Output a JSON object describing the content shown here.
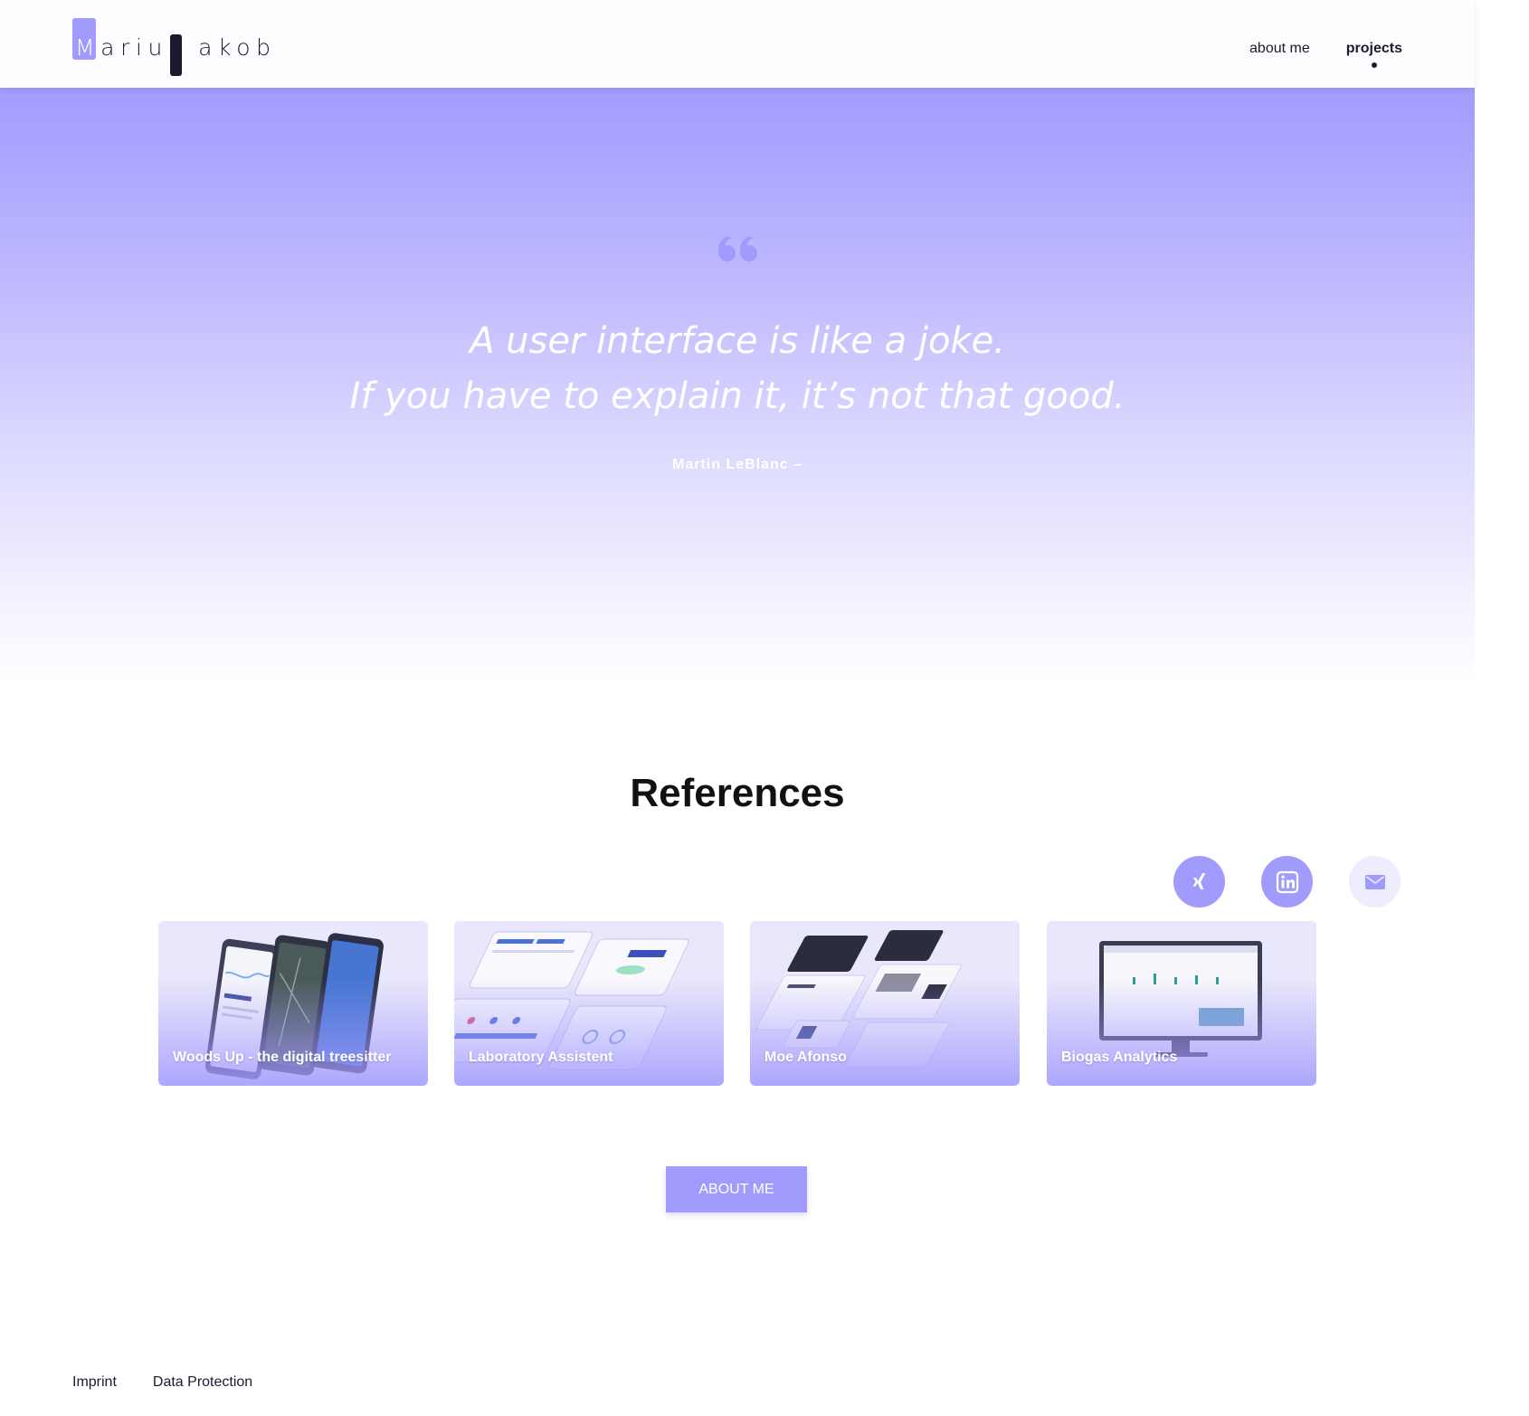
{
  "brand": {
    "first": "arius",
    "first_initial": "M",
    "last_initial": "j",
    "last": "akob",
    "accent_color": "#a29bfe",
    "dark_color": "#1c1a2e"
  },
  "nav": {
    "items": [
      {
        "label": "about me",
        "active": false
      },
      {
        "label": "projects",
        "active": true
      }
    ]
  },
  "hero": {
    "quote_icon": "quote-icon",
    "quote_line1": "A user interface is like a joke.",
    "quote_line2": "If you have to explain it, it’s not that good.",
    "author": "Martin LeBlanc –"
  },
  "references": {
    "title": "References",
    "social": [
      {
        "name": "xing-icon"
      },
      {
        "name": "linkedin-icon"
      },
      {
        "name": "mail-icon"
      }
    ],
    "cards": [
      {
        "label": "Woods Up - the digital treesitter"
      },
      {
        "label": "Laboratory Assistent"
      },
      {
        "label": "Moe Afonso"
      },
      {
        "label": "Biogas Analytics"
      }
    ]
  },
  "cta": {
    "about_label": "ABOUT ME"
  },
  "footer": {
    "links": [
      {
        "label": "Imprint"
      },
      {
        "label": "Data Protection"
      }
    ]
  }
}
